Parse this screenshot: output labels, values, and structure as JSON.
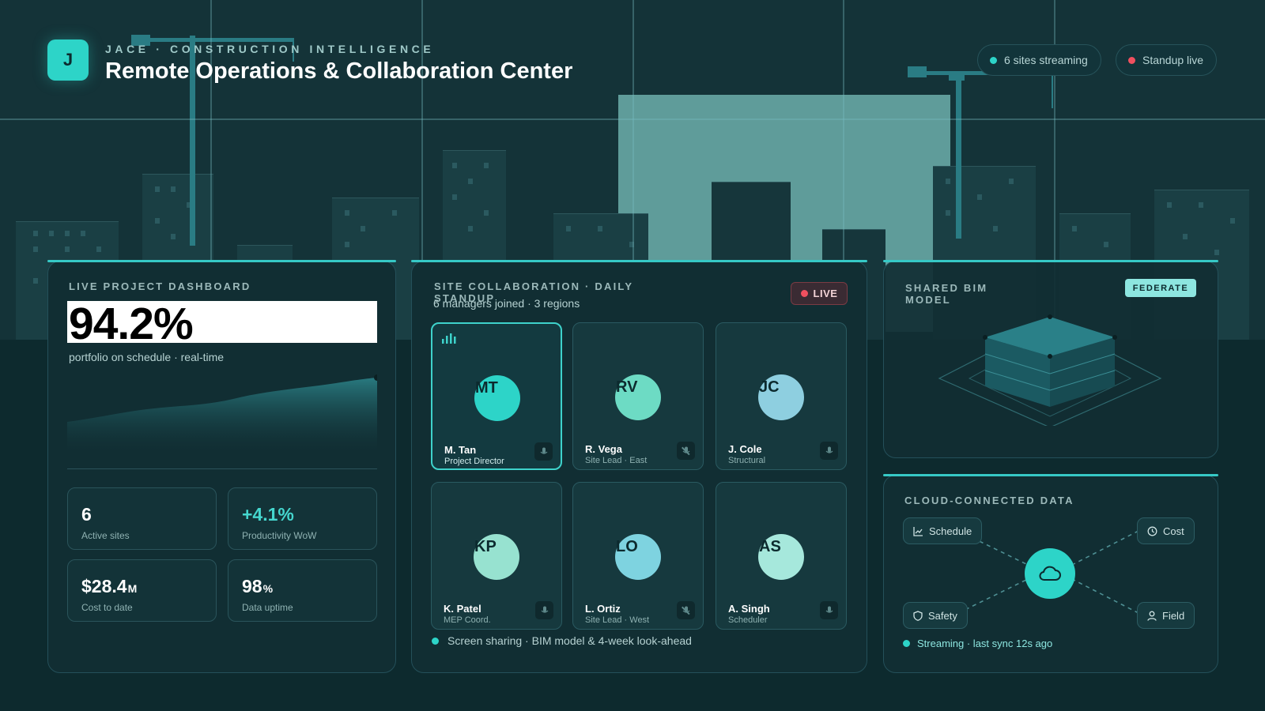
{
  "header": {
    "logo_letter": "J",
    "brand": "JACE · CONSTRUCTION INTELLIGENCE",
    "title": "Remote Operations & Collaboration Center",
    "status_pills": [
      {
        "label": "6 sites streaming",
        "dot_color": "#2dd4c8"
      },
      {
        "label": "Standup live",
        "dot_color": "#f0505f"
      }
    ]
  },
  "dashboard": {
    "label": "LIVE PROJECT DASHBOARD",
    "kpi_value": "94.2%",
    "kpi_caption": "portfolio on schedule · real-time",
    "stats": [
      {
        "value": "6",
        "unit": "",
        "label": "Active  sites",
        "accent": false
      },
      {
        "value": "+4.1%",
        "unit": "",
        "label": "Productivity  WoW",
        "accent": true
      },
      {
        "value": "$28.4",
        "unit": "M",
        "label": "Cost to date",
        "accent": false
      },
      {
        "value": "98",
        "unit": "%",
        "label": "Data uptime",
        "accent": false
      }
    ]
  },
  "collaboration": {
    "label_line1": "SITE COLLABORATION · DAILY",
    "label_line2": "STANDUP",
    "live_label": "LIVE",
    "subtitle": "6 managers joined · 3 regions",
    "participants": [
      {
        "initials": "MT",
        "name": "M. Tan",
        "role": "Project Director",
        "avatar_color": "#2dd4c8",
        "active": true,
        "muted": false
      },
      {
        "initials": "RV",
        "name": "R. Vega",
        "role": "Site Lead · East",
        "avatar_color": "#6ddbc4",
        "active": false,
        "muted": true
      },
      {
        "initials": "JC",
        "name": "J. Cole",
        "role": "Structural",
        "avatar_color": "#8ecfe0",
        "active": false,
        "muted": false
      },
      {
        "initials": "KP",
        "name": "K. Patel",
        "role": "MEP  Coord.",
        "avatar_color": "#97e2d0",
        "active": false,
        "muted": false
      },
      {
        "initials": "LO",
        "name": "L. Ortiz",
        "role": "Site Lead · West",
        "avatar_color": "#7ed3e0",
        "active": false,
        "muted": true
      },
      {
        "initials": "AS",
        "name": "A. Singh",
        "role": "Scheduler",
        "avatar_color": "#a6e8dc",
        "active": false,
        "muted": false
      }
    ],
    "footer": "Screen sharing · BIM model & 4-week look-ahead"
  },
  "bim": {
    "label_line1": "SHARED BIM",
    "label_line2": "MODEL",
    "federate_label": "FEDERATE"
  },
  "cloud": {
    "label": "CLOUD-CONNECTED DATA",
    "nodes": [
      {
        "label": "Schedule",
        "icon": "chart-icon"
      },
      {
        "label": "Cost",
        "icon": "clock-icon"
      },
      {
        "label": "Safety",
        "icon": "shield-icon"
      },
      {
        "label": "Field",
        "icon": "person-icon"
      }
    ],
    "footer": "Streaming · last sync 12s ago"
  },
  "colors": {
    "accent": "#2dd4c8",
    "live_red": "#f0505f",
    "background": "#0c2a2e"
  }
}
